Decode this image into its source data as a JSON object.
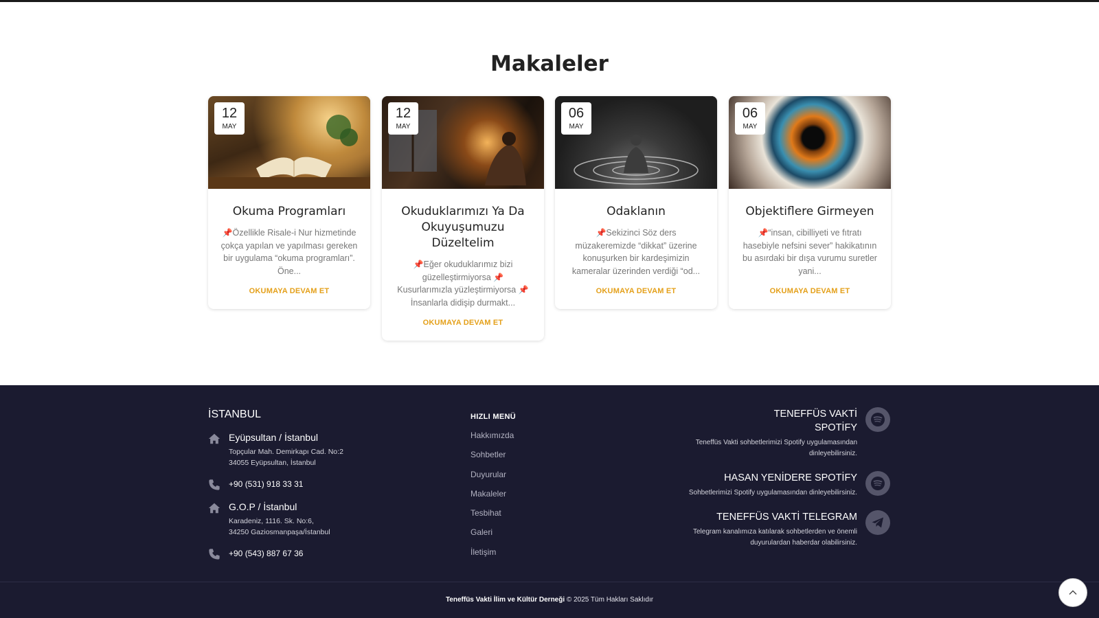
{
  "section": {
    "title": "Makaleler"
  },
  "articles": [
    {
      "day": "12",
      "month": "MAY",
      "title": "Okuma Programları",
      "pin": "📌",
      "excerpt": "Özellikle Risale-i Nur hizmetinde çokça yapılan ve yapılması gereken bir uygulama “okuma programları”. Öne...",
      "link": "OKUMAYA DEVAM ET"
    },
    {
      "day": "12",
      "month": "MAY",
      "title": "Okuduklarımızı Ya Da Okuyuşumuzu Düzeltelim",
      "pin": "📌",
      "excerpt_1": "Eğer okuduklarımız bizi güzelleştirmiyorsa ",
      "excerpt_2": " Kusurlarımızla yüzleştirmiyorsa ",
      "excerpt_3": " İnsanlarla didişip durmakt...",
      "link": "OKUMAYA DEVAM ET"
    },
    {
      "day": "06",
      "month": "MAY",
      "title": "Odaklanın",
      "pin": "📌",
      "excerpt": "Sekizinci Söz ders müzakeremizde “dikkat” üzerine konuşurken bir kardeşimizin kameralar üzerinden verdiği “od...",
      "link": "OKUMAYA DEVAM ET"
    },
    {
      "day": "06",
      "month": "MAY",
      "title": "Objektiflere Girmeyen",
      "pin": "📌",
      "excerpt": "“insan, cibilliyeti ve fıtratı hasebiyle nefsini sever” hakikatının bu asırdaki bir dışa vurumu suretler yani...",
      "link": "OKUMAYA DEVAM ET"
    }
  ],
  "footer": {
    "city": "İSTANBUL",
    "addresses": [
      {
        "title": "Eyüpsultan / İstanbul",
        "line1": "Topçular Mah. Demirkapı Cad. No:2",
        "line2": "34055 Eyüpsultan, İstanbul",
        "phone": "+90 (531) 918 33 31"
      },
      {
        "title": "G.O.P / İstanbul",
        "line1": "Karadeniz, 1116. Sk. No:6,",
        "line2": "34250 Gaziosmanpaşa/İstanbul",
        "phone": "+90 (543) 887 67 36"
      }
    ],
    "menu_title": "HIZLI MENÜ",
    "menu": [
      "Hakkımızda",
      "Sohbetler",
      "Duyurular",
      "Makaleler",
      "Tesbihat",
      "Galeri",
      "İletişim"
    ],
    "social": [
      {
        "title_1": "TENEFFÜS VAKTİ",
        "title_2": "SPOTİFY",
        "desc_1": "Teneffüs Vakti sohbetlerimizi Spotify uygulamasından",
        "desc_2": "dinleyebilirsiniz.",
        "icon": "spotify-icon"
      },
      {
        "title_1": "HASAN YENİDERE SPOTİFY",
        "desc_1": "Sohbetlerimizi Spotify uygulamasından dinleyebilirsiniz.",
        "icon": "spotify-icon"
      },
      {
        "title_1": "TENEFFÜS VAKTİ TELEGRAM",
        "desc_1": "Telegram kanalımıza katılarak sohbetlerden ve önemli",
        "desc_2": "duyurulardan haberdar olabilirsiniz.",
        "icon": "telegram-icon"
      }
    ],
    "copyright_org": "Teneffüs Vakti İlim ve Kültür Derneği",
    "copyright_sign": "©",
    "copyright_text": " 2025 Tüm Hakları Saklıdır"
  },
  "colors": {
    "footer_bg": "#1b1b30",
    "accent": "#e4a01a",
    "pin": "#d62b2b"
  }
}
